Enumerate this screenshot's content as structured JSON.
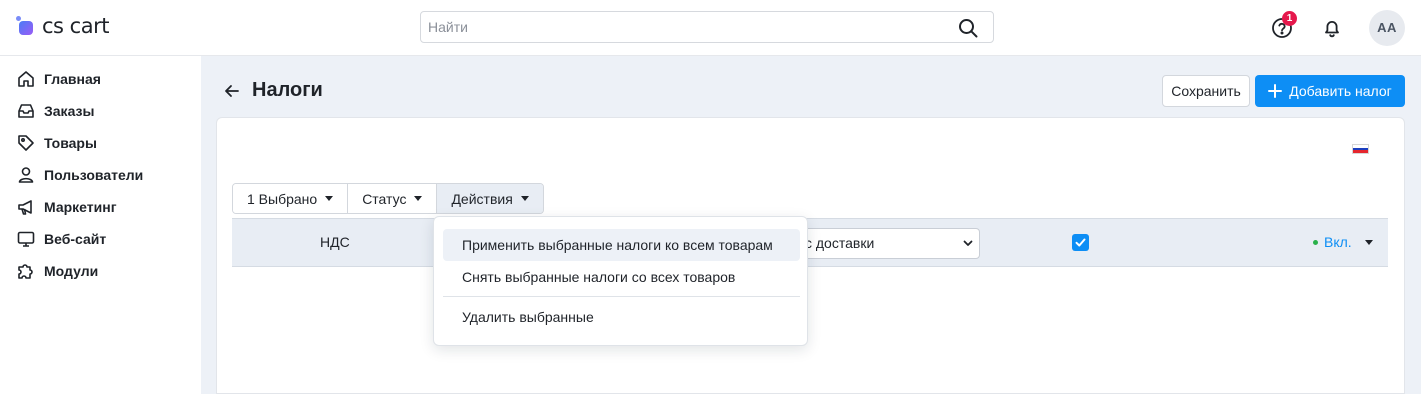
{
  "brand": {
    "name": "cs cart"
  },
  "search": {
    "placeholder": "Найти",
    "value": ""
  },
  "header": {
    "notifications_badge": "1",
    "avatar_initials": "AA"
  },
  "sidebar": {
    "items": [
      {
        "label": "Главная",
        "icon": "home-icon"
      },
      {
        "label": "Заказы",
        "icon": "inbox-icon"
      },
      {
        "label": "Товары",
        "icon": "tag-icon"
      },
      {
        "label": "Пользователи",
        "icon": "user-icon"
      },
      {
        "label": "Маркетинг",
        "icon": "megaphone-icon"
      },
      {
        "label": "Веб-сайт",
        "icon": "monitor-icon"
      },
      {
        "label": "Модули",
        "icon": "puzzle-icon"
      }
    ]
  },
  "page": {
    "title": "Налоги",
    "save_label": "Сохранить",
    "add_label": "Добавить налог"
  },
  "toolbar": {
    "selected_label": "1 Выбрано",
    "status_label": "Статус",
    "actions_label": "Действия"
  },
  "actions_menu": {
    "items": [
      "Применить выбранные налоги ко всем товарам",
      "Снять выбранные налоги со всех товаров",
      "Удалить выбранные"
    ]
  },
  "table": {
    "rows": [
      {
        "name": "НДС",
        "rate_area": "с доставки",
        "checked": true,
        "status": "Вкл."
      }
    ]
  },
  "colors": {
    "accent": "#0d8ef5",
    "badge": "#e5184c",
    "status_active": "#29b14a",
    "main_bg": "#edf1f7"
  },
  "language_flag": "ru-flag-icon"
}
